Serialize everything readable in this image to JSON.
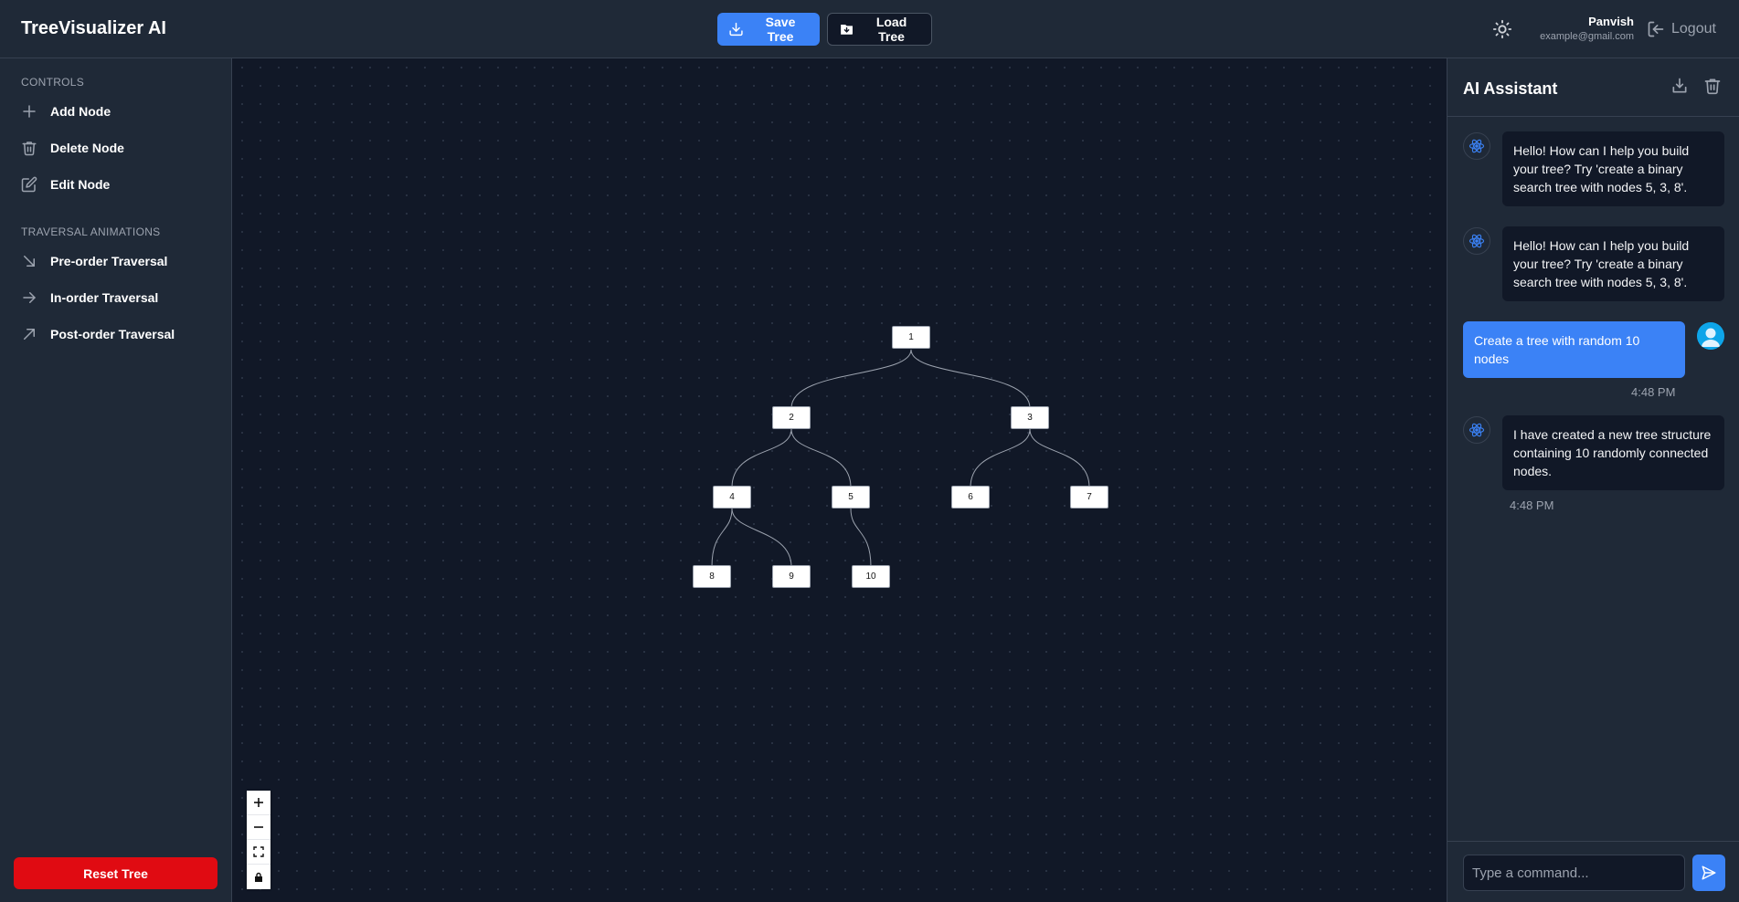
{
  "header": {
    "title": "TreeVisualizer AI",
    "save_label": "Save Tree",
    "load_label": "Load Tree",
    "user_name": "Panvish",
    "user_email": "example@gmail.com",
    "logout_label": "Logout"
  },
  "sidebar": {
    "controls_title": "CONTROLS",
    "controls": [
      {
        "label": "Add Node",
        "icon": "plus-icon"
      },
      {
        "label": "Delete Node",
        "icon": "trash-icon"
      },
      {
        "label": "Edit Node",
        "icon": "edit-icon"
      }
    ],
    "traversal_title": "TRAVERSAL ANIMATIONS",
    "traversals": [
      {
        "label": "Pre-order Traversal",
        "icon": "arrow-down-right-icon"
      },
      {
        "label": "In-order Traversal",
        "icon": "arrow-right-icon"
      },
      {
        "label": "Post-order Traversal",
        "icon": "arrow-up-right-icon"
      }
    ],
    "reset_label": "Reset Tree",
    "reset_color": "#e00b12"
  },
  "tree": {
    "nodes": [
      "1",
      "2",
      "3",
      "4",
      "5",
      "6",
      "7",
      "8",
      "9",
      "10"
    ],
    "edges": [
      [
        "1",
        "2"
      ],
      [
        "1",
        "3"
      ],
      [
        "2",
        "4"
      ],
      [
        "2",
        "5"
      ],
      [
        "3",
        "6"
      ],
      [
        "3",
        "7"
      ],
      [
        "4",
        "8"
      ],
      [
        "4",
        "9"
      ],
      [
        "5",
        "10"
      ]
    ]
  },
  "assistant": {
    "title": "AI Assistant",
    "messages": [
      {
        "role": "bot",
        "text": "Hello! How can I help you build your tree? Try 'create a binary search tree with nodes 5, 3, 8'."
      },
      {
        "role": "bot",
        "text": "Hello! How can I help you build your tree? Try 'create a binary search tree with nodes 5, 3, 8'."
      },
      {
        "role": "user",
        "text": "Create a tree with random 10 nodes",
        "time": "4:48 PM"
      },
      {
        "role": "bot",
        "text": "I have created a new tree structure containing 10 randomly connected nodes.",
        "time": "4:48 PM"
      }
    ],
    "input_placeholder": "Type a command...",
    "accent": "#3b82f6"
  }
}
